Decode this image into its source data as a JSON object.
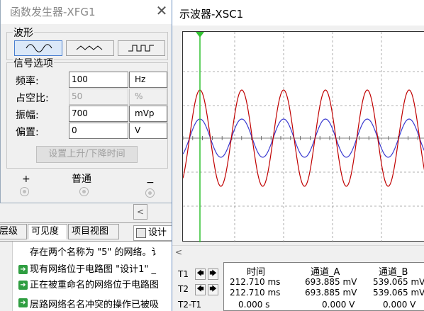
{
  "background_app": {
    "tabs": [
      "层级",
      "可见度",
      "项目视图"
    ],
    "design_tab": "设计",
    "scroll_left_arrow": "<",
    "messages": [
      "存在两个名称为 \"5\" 的网络。讠",
      "现有网络位于电路图 \"设计1\" _",
      "正在被重命名的网络位于电路图",
      "层路网络名名冲突的操作已被吸"
    ]
  },
  "function_generator": {
    "title": "函数发生器-XFG1",
    "close_glyph": "✕",
    "waveform_group_label": "波形",
    "waveforms": [
      {
        "name": "sine",
        "selected": true
      },
      {
        "name": "triangle",
        "selected": false
      },
      {
        "name": "square",
        "selected": false
      }
    ],
    "signal_options_label": "信号选项",
    "fields": [
      {
        "label": "频率:",
        "value": "100",
        "unit": "Hz",
        "disabled": false
      },
      {
        "label": "占空比:",
        "value": "50",
        "unit": "%",
        "disabled": true
      },
      {
        "label": "振幅:",
        "value": "700",
        "unit": "mVp",
        "disabled": false
      },
      {
        "label": "偏置:",
        "value": "0",
        "unit": "V",
        "disabled": false
      }
    ],
    "rise_fall_button": "设置上升/下降时间",
    "terminals": {
      "plus": "+",
      "common": "普通",
      "minus": "−"
    }
  },
  "oscilloscope": {
    "title": "示波器-XSC1",
    "scroll_left_arrow": "<",
    "colors": {
      "channel_a": "#c00000",
      "channel_b": "#3a3ad0",
      "cursor": "#33c233",
      "grid": "#999999"
    },
    "cursors": {
      "t1_label": "T1",
      "t2_label": "T2",
      "diff_label": "T2-T1",
      "left_arrow": "🡄",
      "right_arrow": "🡆"
    },
    "readout": {
      "headers": [
        "时间",
        "通道_A",
        "通道_B"
      ],
      "rows": [
        [
          "212.710 ms",
          "693.885 mV",
          "539.065 mV"
        ],
        [
          "212.710 ms",
          "693.885 mV",
          "539.065 mV"
        ],
        [
          "0.000 s",
          "0.000 V",
          "0.000 V"
        ]
      ]
    }
  }
}
